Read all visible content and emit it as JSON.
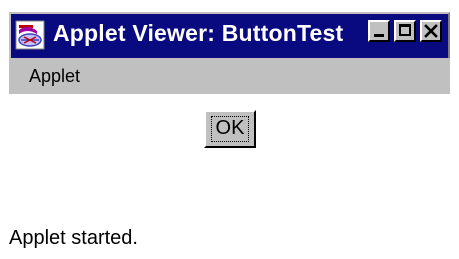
{
  "window": {
    "title": "Applet Viewer: ButtonTest",
    "titlebar_color": "#0a0a80",
    "chrome_color": "#c0c0c0"
  },
  "icons": {
    "app": "applet-viewer-icon",
    "minimize": "minimize-icon",
    "maximize": "maximize-icon",
    "close": "close-icon"
  },
  "menubar": {
    "items": [
      {
        "label": "Applet"
      }
    ]
  },
  "applet": {
    "button_label": "OK"
  },
  "status": {
    "text": "Applet started."
  }
}
